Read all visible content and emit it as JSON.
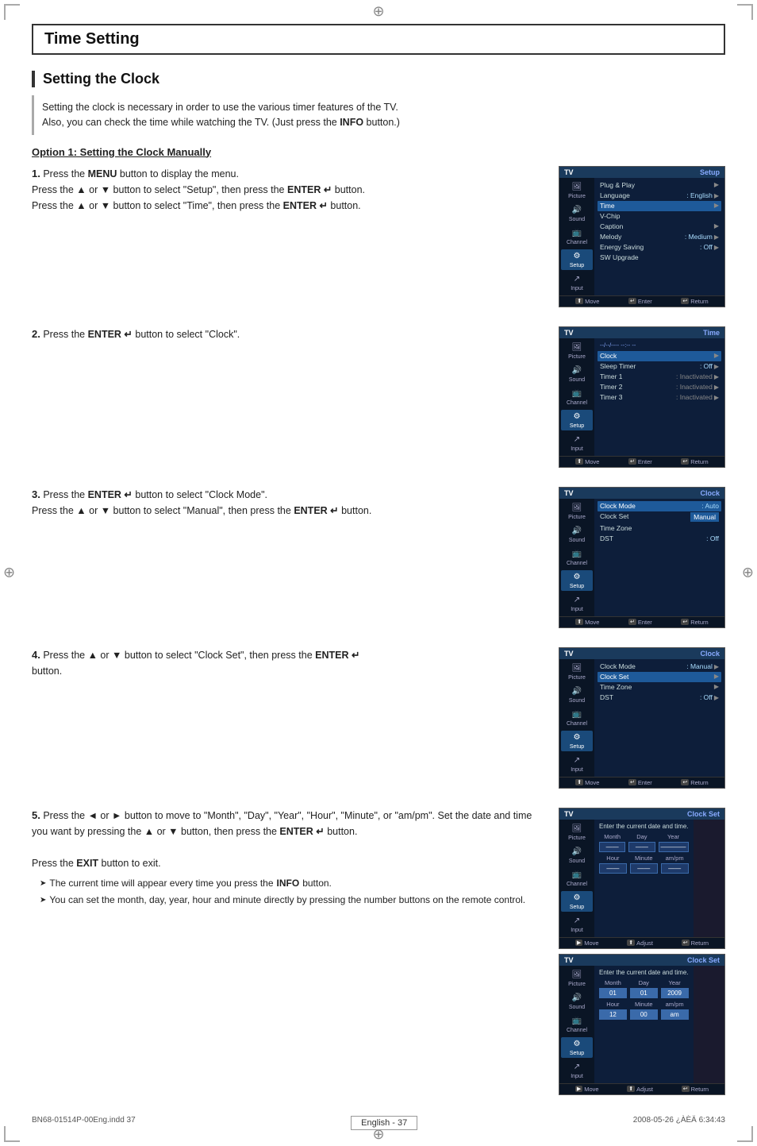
{
  "page": {
    "crosshair_symbol": "⊕",
    "corner_marks": true
  },
  "main_title": "Time Setting",
  "section_title": "Setting the Clock",
  "intro": {
    "line1": "Setting the clock is necessary in order to use the various timer features of the TV.",
    "line2": "Also, you can check the time while watching the TV. (Just press the ",
    "line2_bold": "INFO",
    "line2_end": " button.)"
  },
  "option_heading": "Option 1: Setting the Clock Manually",
  "steps": [
    {
      "num": "1.",
      "text_parts": [
        {
          "text": "Press the ",
          "bold": false
        },
        {
          "text": "MENU",
          "bold": true
        },
        {
          "text": " button to display the menu.",
          "bold": false
        },
        {
          "text": "\nPress the ▲ or ▼ button to select \"Setup\", then press the ",
          "bold": false
        },
        {
          "text": "ENTER ",
          "bold": true
        },
        {
          "text": "↵ button.",
          "bold": false
        },
        {
          "text": "\nPress the ▲ or ▼ button to select \"Time\", then press the ",
          "bold": false
        },
        {
          "text": "ENTER ",
          "bold": true
        },
        {
          "text": "↵ button.",
          "bold": false
        }
      ],
      "menu": "setup"
    },
    {
      "num": "2.",
      "text_parts": [
        {
          "text": "Press the ",
          "bold": false
        },
        {
          "text": "ENTER ",
          "bold": true
        },
        {
          "text": "↵ button to select \"Clock\".",
          "bold": false
        }
      ],
      "menu": "time"
    },
    {
      "num": "3.",
      "text_parts": [
        {
          "text": "Press the ",
          "bold": false
        },
        {
          "text": "ENTER ",
          "bold": true
        },
        {
          "text": "↵ button to select \"Clock Mode\".",
          "bold": false
        },
        {
          "text": "\nPress the ▲ or ▼ button to select \"Manual\", then press the ",
          "bold": false
        },
        {
          "text": "ENTER ",
          "bold": true
        },
        {
          "text": "↵ button.",
          "bold": false
        }
      ],
      "menu": "clock_mode"
    },
    {
      "num": "4.",
      "text_parts": [
        {
          "text": "Press the ▲ or ▼ button to select \"Clock Set\", then press the ",
          "bold": false
        },
        {
          "text": "ENTER ",
          "bold": true
        },
        {
          "text": "↵",
          "bold": false
        },
        {
          "text": "\nbutton.",
          "bold": false
        }
      ],
      "menu": "clock_set_select"
    },
    {
      "num": "5.",
      "text_parts": [
        {
          "text": "Press the ◄ or ► button to move to \"Month\", \"Day\", \"Year\", \"Hour\", \"Minute\",\nor \"am/pm\". Set the date and time you want by pressing the ▲ or ▼ button,\nthen press the ",
          "bold": false
        },
        {
          "text": "ENTER ",
          "bold": true
        },
        {
          "text": "↵ button.",
          "bold": false
        },
        {
          "text": "\nPress the ",
          "bold": false
        },
        {
          "text": "EXIT",
          "bold": true
        },
        {
          "text": " button to exit.",
          "bold": false
        }
      ],
      "sub_bullets": [
        "The current time will appear every time you press the INFO button.",
        "You can set the month, day, year, hour and minute directly by pressing the number buttons on the remote control."
      ],
      "menu": "clock_set_empty",
      "menu2": "clock_set_filled"
    }
  ],
  "menus": {
    "setup": {
      "header_tv": "TV",
      "header_title": "Setup",
      "sidebar_items": [
        "Picture",
        "Sound",
        "Channel",
        "Setup",
        "Input"
      ],
      "active_sidebar": "Setup",
      "items": [
        {
          "label": "Plug & Play",
          "value": "",
          "arrow": true
        },
        {
          "label": "Language",
          "value": ": English",
          "arrow": true
        },
        {
          "label": "Time",
          "value": "",
          "arrow": true,
          "highlighted": true
        },
        {
          "label": "V-Chip",
          "value": "",
          "arrow": false
        },
        {
          "label": "Caption",
          "value": "",
          "arrow": true
        },
        {
          "label": "Melody",
          "value": ": Medium",
          "arrow": true
        },
        {
          "label": "Energy Saving",
          "value": ": Off",
          "arrow": true
        },
        {
          "label": "SW Upgrade",
          "value": "",
          "arrow": false
        }
      ],
      "footer": [
        "Move",
        "Enter",
        "Return"
      ]
    },
    "time": {
      "header_tv": "TV",
      "header_title": "Time",
      "active_sidebar": "Setup",
      "time_display": "--/--/----  --:-- --",
      "items": [
        {
          "label": "Clock",
          "value": "",
          "arrow": true,
          "highlighted": true
        },
        {
          "label": "Sleep Timer",
          "value": ": Off",
          "arrow": true
        },
        {
          "label": "Timer 1",
          "value": ": Inactivated",
          "arrow": true
        },
        {
          "label": "Timer 2",
          "value": ": Inactivated",
          "arrow": true
        },
        {
          "label": "Timer 3",
          "value": ": Inactivated",
          "arrow": true
        }
      ],
      "footer": [
        "Move",
        "Enter",
        "Return"
      ]
    },
    "clock_mode": {
      "header_tv": "TV",
      "header_title": "Clock",
      "active_sidebar": "Setup",
      "items": [
        {
          "label": "Clock Mode",
          "value": ": Auto",
          "arrow": false
        },
        {
          "label": "Clock Set",
          "value": "",
          "arrow": false,
          "sub_highlight": "Manual"
        },
        {
          "label": "Time Zone",
          "value": "",
          "arrow": false
        },
        {
          "label": "DST",
          "value": ": Off",
          "arrow": false
        }
      ],
      "footer": [
        "Move",
        "Enter",
        "Return"
      ]
    },
    "clock_set_select": {
      "header_tv": "TV",
      "header_title": "Clock",
      "active_sidebar": "Setup",
      "items": [
        {
          "label": "Clock Mode",
          "value": ": Manual",
          "arrow": true
        },
        {
          "label": "Clock Set",
          "value": "",
          "arrow": true,
          "highlighted": true
        },
        {
          "label": "Time Zone",
          "value": "",
          "arrow": true
        },
        {
          "label": "DST",
          "value": ": Off",
          "arrow": true
        }
      ],
      "footer": [
        "Move",
        "Enter",
        "Return"
      ]
    },
    "clock_set_empty": {
      "header_tv": "TV",
      "header_title": "Clock Set",
      "label": "Enter the current date and time.",
      "month_label": "Month",
      "day_label": "Day",
      "year_label": "Year",
      "hour_label": "Hour",
      "minute_label": "Minute",
      "ampm_label": "am/pm",
      "month_val": "",
      "day_val": "",
      "year_val": "",
      "hour_val": "",
      "minute_val": "",
      "ampm_val": "",
      "footer": [
        "Move",
        "Adjust",
        "Return"
      ]
    },
    "clock_set_filled": {
      "header_tv": "TV",
      "header_title": "Clock Set",
      "label": "Enter the current date and time.",
      "month_label": "Month",
      "day_label": "Day",
      "year_label": "Year",
      "hour_label": "Hour",
      "minute_label": "Minute",
      "ampm_label": "am/pm",
      "month_val": "01",
      "day_val": "01",
      "year_val": "2009",
      "hour_val": "12",
      "minute_val": "00",
      "ampm_val": "am",
      "footer": [
        "Move",
        "Adjust",
        "Return"
      ]
    }
  },
  "footer": {
    "left_text": "BN68-01514P-00Eng.indd   37",
    "page_number": "English - 37",
    "right_text": "2008-05-26   ¿ÀÈÄ 6:34:43"
  }
}
